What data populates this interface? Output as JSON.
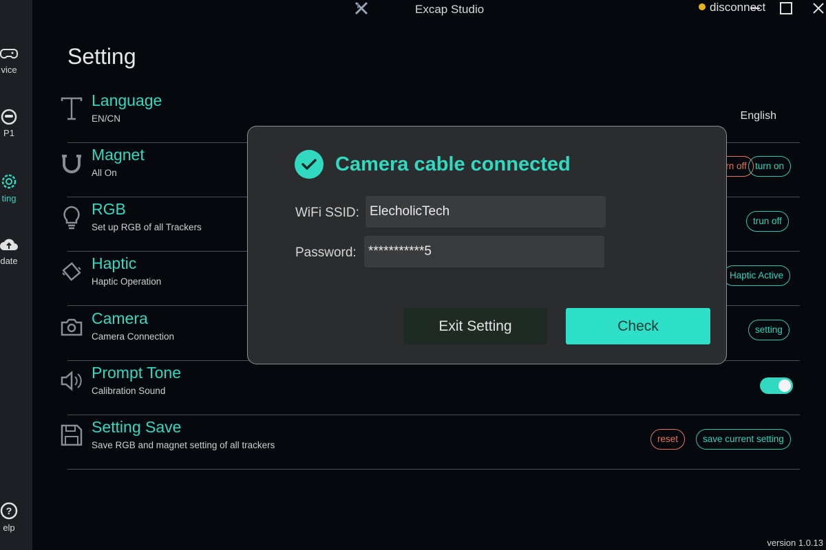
{
  "window": {
    "title": "Excap Studio",
    "status": "disconnect",
    "status_color": "#e8b418",
    "accent_color": "#30d9c0"
  },
  "sidebar": {
    "items": [
      {
        "label": "vice",
        "icon": "gamepad-icon"
      },
      {
        "label": "P1",
        "icon": "face-icon"
      },
      {
        "label": "ting",
        "icon": "gear-icon",
        "active": true
      },
      {
        "label": "date",
        "icon": "cloud-upload-icon"
      },
      {
        "label": "elp",
        "icon": "help-icon"
      }
    ]
  },
  "page": {
    "title": "Setting",
    "version": "version 1.0.13"
  },
  "settings": {
    "language": {
      "title": "Language",
      "sub": "EN/CN",
      "value": "English",
      "icon": "text-icon"
    },
    "magnet": {
      "title": "Magnet",
      "sub": "All On",
      "btn_off": "turn off",
      "btn_on": "turn on",
      "icon": "magnet-icon"
    },
    "rgb": {
      "title": "RGB",
      "sub": "Set up RGB of all Trackers",
      "btn": "trun off",
      "icon": "lightbulb-icon"
    },
    "haptic": {
      "title": "Haptic",
      "sub": "Haptic Operation",
      "btn": "Haptic Active",
      "icon": "vibration-icon"
    },
    "camera": {
      "title": "Camera",
      "sub": "Camera Connection",
      "btn": "setting",
      "icon": "camera-icon"
    },
    "prompt": {
      "title": "Prompt Tone",
      "sub": "Calibration Sound",
      "toggle_on": true,
      "icon": "speaker-icon"
    },
    "save": {
      "title": "Setting Save",
      "sub": "Save RGB and magnet setting of all trackers",
      "btn_reset": "reset",
      "btn_save": "save current setting",
      "icon": "floppy-disk-icon"
    }
  },
  "dialog": {
    "title": "Camera cable connected",
    "ssid_label": "WiFi SSID:",
    "ssid_value": "ElecholicTech",
    "password_label": "Password:",
    "password_value": "***********5",
    "exit_label": "Exit Setting",
    "check_label": "Check"
  }
}
